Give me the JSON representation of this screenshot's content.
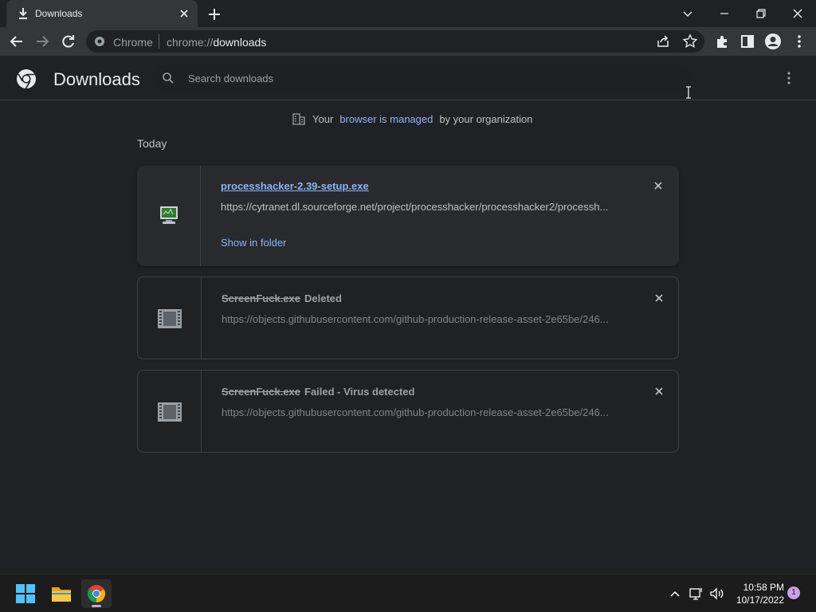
{
  "browser": {
    "tab": {
      "title": "Downloads"
    },
    "omnibox": {
      "origin_label": "Chrome",
      "url_prefix": "chrome://",
      "url_host": "downloads"
    }
  },
  "downloads_page": {
    "title": "Downloads",
    "search_placeholder": "Search downloads",
    "managed_notice": {
      "prefix": "Your",
      "link": "browser is managed",
      "suffix": "by your organization"
    },
    "section_label": "Today",
    "items": [
      {
        "filename": "processhacker-2.39-setup.exe",
        "status": "",
        "url": "https://cytranet.dl.sourceforge.net/project/processhacker/processhacker2/processh...",
        "action": "Show in folder",
        "state": "complete"
      },
      {
        "filename": "ScreenFuck.exe",
        "status": "Deleted",
        "url": "https://objects.githubusercontent.com/github-production-release-asset-2e65be/246...",
        "action": "",
        "state": "deleted"
      },
      {
        "filename": "ScreenFuck.exe",
        "status": "Failed - Virus detected",
        "url": "https://objects.githubusercontent.com/github-production-release-asset-2e65be/246...",
        "action": "",
        "state": "failed"
      }
    ]
  },
  "taskbar": {
    "time": "10:58 PM",
    "date": "10/17/2022",
    "notification_count": "1"
  },
  "colors": {
    "accent_link": "#8ab4f8",
    "page_bg": "#202124",
    "toolbar_bg": "#35363a",
    "taskbar_bg": "#1c1c1c",
    "notification_badge": "#c7a2e8"
  },
  "icons": [
    "download-icon",
    "close-icon",
    "new-tab-icon",
    "tab-search-icon",
    "minimize-icon",
    "restore-icon",
    "window-close-icon",
    "back-icon",
    "forward-icon",
    "reload-icon",
    "chrome-site-icon",
    "share-icon",
    "bookmark-star-icon",
    "extensions-icon",
    "side-panel-icon",
    "profile-icon",
    "menu-icon",
    "chrome-logo-icon",
    "search-icon",
    "building-icon",
    "text-cursor-icon",
    "windows-start-icon",
    "file-explorer-icon",
    "chrome-app-icon",
    "chevron-up-icon",
    "network-icon",
    "volume-icon"
  ]
}
